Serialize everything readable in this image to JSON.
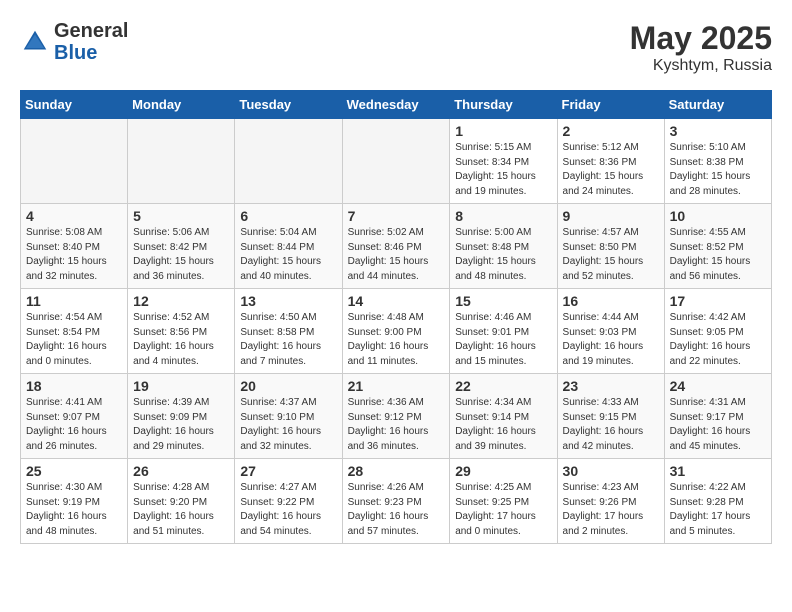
{
  "header": {
    "logo_general": "General",
    "logo_blue": "Blue",
    "month_title": "May 2025",
    "location": "Kyshtym, Russia"
  },
  "weekdays": [
    "Sunday",
    "Monday",
    "Tuesday",
    "Wednesday",
    "Thursday",
    "Friday",
    "Saturday"
  ],
  "weeks": [
    [
      {
        "day": "",
        "info": ""
      },
      {
        "day": "",
        "info": ""
      },
      {
        "day": "",
        "info": ""
      },
      {
        "day": "",
        "info": ""
      },
      {
        "day": "1",
        "info": "Sunrise: 5:15 AM\nSunset: 8:34 PM\nDaylight: 15 hours\nand 19 minutes."
      },
      {
        "day": "2",
        "info": "Sunrise: 5:12 AM\nSunset: 8:36 PM\nDaylight: 15 hours\nand 24 minutes."
      },
      {
        "day": "3",
        "info": "Sunrise: 5:10 AM\nSunset: 8:38 PM\nDaylight: 15 hours\nand 28 minutes."
      }
    ],
    [
      {
        "day": "4",
        "info": "Sunrise: 5:08 AM\nSunset: 8:40 PM\nDaylight: 15 hours\nand 32 minutes."
      },
      {
        "day": "5",
        "info": "Sunrise: 5:06 AM\nSunset: 8:42 PM\nDaylight: 15 hours\nand 36 minutes."
      },
      {
        "day": "6",
        "info": "Sunrise: 5:04 AM\nSunset: 8:44 PM\nDaylight: 15 hours\nand 40 minutes."
      },
      {
        "day": "7",
        "info": "Sunrise: 5:02 AM\nSunset: 8:46 PM\nDaylight: 15 hours\nand 44 minutes."
      },
      {
        "day": "8",
        "info": "Sunrise: 5:00 AM\nSunset: 8:48 PM\nDaylight: 15 hours\nand 48 minutes."
      },
      {
        "day": "9",
        "info": "Sunrise: 4:57 AM\nSunset: 8:50 PM\nDaylight: 15 hours\nand 52 minutes."
      },
      {
        "day": "10",
        "info": "Sunrise: 4:55 AM\nSunset: 8:52 PM\nDaylight: 15 hours\nand 56 minutes."
      }
    ],
    [
      {
        "day": "11",
        "info": "Sunrise: 4:54 AM\nSunset: 8:54 PM\nDaylight: 16 hours\nand 0 minutes."
      },
      {
        "day": "12",
        "info": "Sunrise: 4:52 AM\nSunset: 8:56 PM\nDaylight: 16 hours\nand 4 minutes."
      },
      {
        "day": "13",
        "info": "Sunrise: 4:50 AM\nSunset: 8:58 PM\nDaylight: 16 hours\nand 7 minutes."
      },
      {
        "day": "14",
        "info": "Sunrise: 4:48 AM\nSunset: 9:00 PM\nDaylight: 16 hours\nand 11 minutes."
      },
      {
        "day": "15",
        "info": "Sunrise: 4:46 AM\nSunset: 9:01 PM\nDaylight: 16 hours\nand 15 minutes."
      },
      {
        "day": "16",
        "info": "Sunrise: 4:44 AM\nSunset: 9:03 PM\nDaylight: 16 hours\nand 19 minutes."
      },
      {
        "day": "17",
        "info": "Sunrise: 4:42 AM\nSunset: 9:05 PM\nDaylight: 16 hours\nand 22 minutes."
      }
    ],
    [
      {
        "day": "18",
        "info": "Sunrise: 4:41 AM\nSunset: 9:07 PM\nDaylight: 16 hours\nand 26 minutes."
      },
      {
        "day": "19",
        "info": "Sunrise: 4:39 AM\nSunset: 9:09 PM\nDaylight: 16 hours\nand 29 minutes."
      },
      {
        "day": "20",
        "info": "Sunrise: 4:37 AM\nSunset: 9:10 PM\nDaylight: 16 hours\nand 32 minutes."
      },
      {
        "day": "21",
        "info": "Sunrise: 4:36 AM\nSunset: 9:12 PM\nDaylight: 16 hours\nand 36 minutes."
      },
      {
        "day": "22",
        "info": "Sunrise: 4:34 AM\nSunset: 9:14 PM\nDaylight: 16 hours\nand 39 minutes."
      },
      {
        "day": "23",
        "info": "Sunrise: 4:33 AM\nSunset: 9:15 PM\nDaylight: 16 hours\nand 42 minutes."
      },
      {
        "day": "24",
        "info": "Sunrise: 4:31 AM\nSunset: 9:17 PM\nDaylight: 16 hours\nand 45 minutes."
      }
    ],
    [
      {
        "day": "25",
        "info": "Sunrise: 4:30 AM\nSunset: 9:19 PM\nDaylight: 16 hours\nand 48 minutes."
      },
      {
        "day": "26",
        "info": "Sunrise: 4:28 AM\nSunset: 9:20 PM\nDaylight: 16 hours\nand 51 minutes."
      },
      {
        "day": "27",
        "info": "Sunrise: 4:27 AM\nSunset: 9:22 PM\nDaylight: 16 hours\nand 54 minutes."
      },
      {
        "day": "28",
        "info": "Sunrise: 4:26 AM\nSunset: 9:23 PM\nDaylight: 16 hours\nand 57 minutes."
      },
      {
        "day": "29",
        "info": "Sunrise: 4:25 AM\nSunset: 9:25 PM\nDaylight: 17 hours\nand 0 minutes."
      },
      {
        "day": "30",
        "info": "Sunrise: 4:23 AM\nSunset: 9:26 PM\nDaylight: 17 hours\nand 2 minutes."
      },
      {
        "day": "31",
        "info": "Sunrise: 4:22 AM\nSunset: 9:28 PM\nDaylight: 17 hours\nand 5 minutes."
      }
    ]
  ]
}
